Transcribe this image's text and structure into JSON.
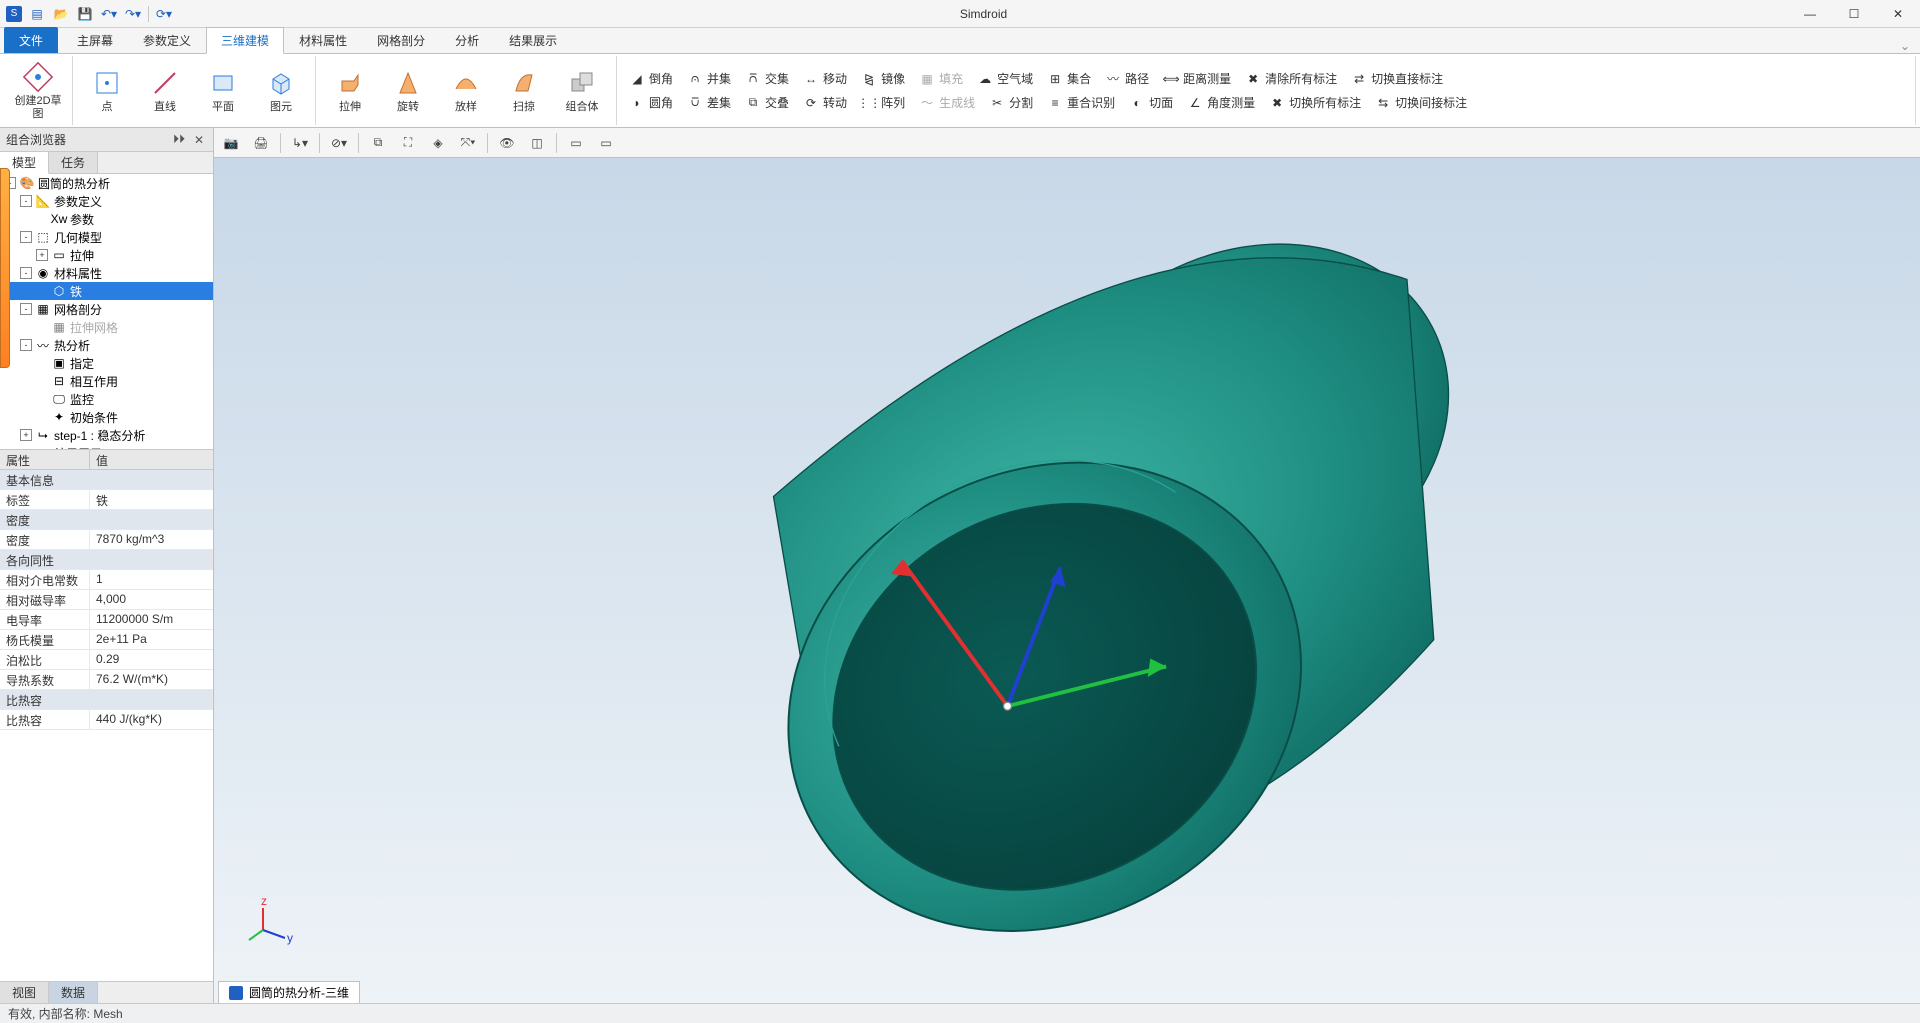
{
  "app": {
    "title": "Simdroid"
  },
  "qat": [
    "app",
    "new",
    "open",
    "save",
    "undo",
    "redo",
    "sep",
    "refresh"
  ],
  "menu": {
    "file": "文件",
    "tabs": [
      "主屏幕",
      "参数定义",
      "三维建模",
      "材料属性",
      "网格剖分",
      "分析",
      "结果展示"
    ],
    "active_index": 2
  },
  "ribbon": {
    "g1": {
      "sketch": "创建2D草图",
      "point": "点",
      "line": "直线",
      "plane": "平面",
      "primitive": "图元"
    },
    "g2": {
      "extrude": "拉伸",
      "revolve": "旋转",
      "scale": "放样",
      "sweep": "扫掠",
      "combine": "组合体"
    },
    "g3": {
      "r1": [
        "倒角",
        "并集",
        "交集",
        "移动",
        "镜像",
        "填充",
        "空气域",
        "集合",
        "路径",
        "距离测量",
        "清除所有标注",
        "切换直接标注"
      ],
      "r2": [
        "圆角",
        "差集",
        "交叠",
        "转动",
        "阵列",
        "生成线",
        "分割",
        "重合识别",
        "切面",
        "角度测量",
        "切换所有标注",
        "切换间接标注"
      ]
    }
  },
  "left": {
    "title": "组合浏览器",
    "tabs": [
      "模型",
      "任务"
    ],
    "tabs_bottom": [
      "视图",
      "数据"
    ],
    "tree": [
      {
        "d": 0,
        "t": "-",
        "i": "root",
        "l": "圆筒的热分析"
      },
      {
        "d": 1,
        "t": "-",
        "i": "param",
        "l": "参数定义"
      },
      {
        "d": 2,
        "t": "",
        "i": "xw",
        "l": "参数"
      },
      {
        "d": 1,
        "t": "-",
        "i": "geom",
        "l": "几何模型"
      },
      {
        "d": 2,
        "t": "+",
        "i": "ext",
        "l": "拉伸"
      },
      {
        "d": 1,
        "t": "-",
        "i": "mat",
        "l": "材料属性"
      },
      {
        "d": 2,
        "t": "",
        "i": "iron",
        "l": "铁",
        "sel": true
      },
      {
        "d": 1,
        "t": "-",
        "i": "mesh",
        "l": "网格剖分"
      },
      {
        "d": 2,
        "t": "",
        "i": "meshP",
        "l": "拉伸网格",
        "dim": true
      },
      {
        "d": 1,
        "t": "-",
        "i": "therm",
        "l": "热分析"
      },
      {
        "d": 2,
        "t": "",
        "i": "assign",
        "l": "指定"
      },
      {
        "d": 2,
        "t": "",
        "i": "inter",
        "l": "相互作用"
      },
      {
        "d": 2,
        "t": "",
        "i": "mon",
        "l": "监控"
      },
      {
        "d": 2,
        "t": "",
        "i": "init",
        "l": "初始条件"
      },
      {
        "d": 1,
        "t": "+",
        "i": "step",
        "l": "step-1 : 稳态分析"
      },
      {
        "d": 1,
        "t": "",
        "i": "res",
        "l": "结果展示"
      }
    ],
    "prop_headers": [
      "属性",
      "值"
    ],
    "props": [
      {
        "section": "基本信息"
      },
      {
        "k": "标签",
        "v": "铁"
      },
      {
        "section": "密度"
      },
      {
        "k": "密度",
        "v": "7870 kg/m^3"
      },
      {
        "section": "各向同性"
      },
      {
        "k": "相对介电常数",
        "v": "1"
      },
      {
        "k": "相对磁导率",
        "v": "4,000"
      },
      {
        "k": "电导率",
        "v": "11200000 S/m"
      },
      {
        "k": "杨氏模量",
        "v": "2e+11 Pa"
      },
      {
        "k": "泊松比",
        "v": "0.29"
      },
      {
        "k": "导热系数",
        "v": "76.2 W/(m*K)"
      },
      {
        "section": "比热容"
      },
      {
        "k": "比热容",
        "v": "440 J/(kg*K)"
      }
    ]
  },
  "viewport": {
    "tab": "圆筒的热分析-三维"
  },
  "status": "有效, 内部名称: Mesh"
}
